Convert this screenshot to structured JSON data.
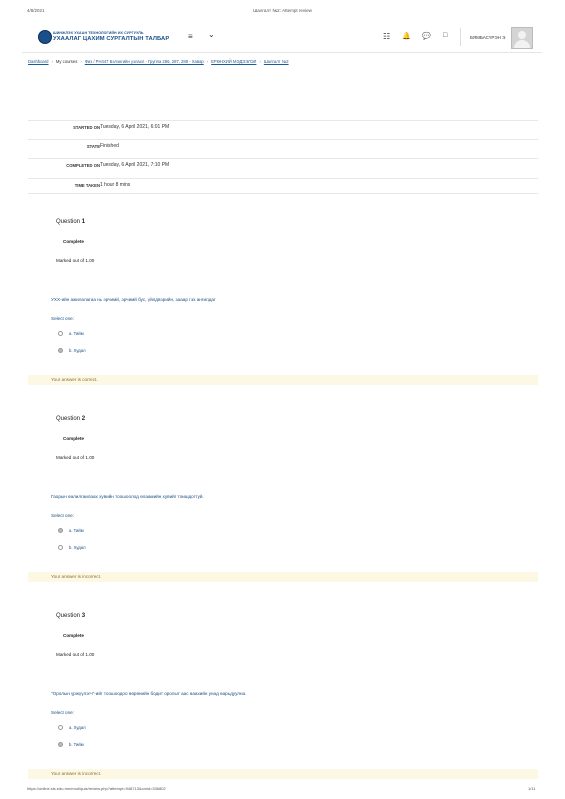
{
  "print_header": {
    "date": "4/8/2021",
    "title": "Шалгалт №2: Attempt review"
  },
  "site": {
    "logo_top": "ШИНЖЛЭХ УХААН ТЕХНОЛОГИЙН ИХ СУРГУУЛЬ",
    "logo_main": "УХААЛАГ ЦАХИМ СУРГАЛТЫН ТАЛБАР"
  },
  "nav": {
    "menu_icon": "≡",
    "dropdown_icon": "⌄",
    "list_icon": "☷",
    "bell_icon": "🔔",
    "chat_icon": "💬",
    "square_icon": "□"
  },
  "user": {
    "name": "БЯМБАСҮРЭН Э"
  },
  "breadcrumb": {
    "items": [
      "Dashboard",
      "My courses",
      "Физ / PH447 Бэлэнгийн узлахл - Группа 286, 287, 288 - Хавар",
      "ЕРӨНХИЙ МЭДЭЭЛЭЛ",
      "Шалгалт №2"
    ]
  },
  "summary": [
    {
      "label": "STARTED ON",
      "value": "Tuesday, 6 April 2021, 6:01 PM"
    },
    {
      "label": "STATE",
      "value": "Finished"
    },
    {
      "label": "COMPLETED ON",
      "value": "Tuesday, 6 April 2021, 7:10 PM"
    },
    {
      "label": "TIME TAKEN",
      "value": "1 hour 8 mins"
    }
  ],
  "questions": [
    {
      "title_prefix": "Question ",
      "number": "1",
      "state": "Complete",
      "mark": "Marked out of 1.00",
      "text": "УХХ-ийн ажилалагаа нь эрчимй, эрчимй бус, үйлдвэрийн, зааар гэх ангилдаг",
      "select": "Select one:",
      "options": [
        "a. Тийм",
        "b. Худал"
      ],
      "selected": 1,
      "feedback": "Your answer is correct."
    },
    {
      "title_prefix": "Question ",
      "number": "2",
      "state": "Complete",
      "mark": "Marked out of 1.00",
      "text": "Гаорын өалилгаилаах хувийн тоошоолод өлаамийн хувийг тоишдогтуй.",
      "select": "Select one:",
      "options": [
        "a. Тийм",
        "b. Худал"
      ],
      "selected": 0,
      "feedback": "Your answer is incorrect."
    },
    {
      "title_prefix": "Question ",
      "number": "3",
      "state": "Complete",
      "mark": "Marked out of 1.00",
      "text": "\"Оролын үржүүлэгч\"-ийг тоошоодоо өөрөнийн бодит оролыт аас өаахийн унад өарьдуулна.",
      "select": "Select one:",
      "options": [
        "a. Худал",
        "b. Тийм"
      ],
      "selected": 1,
      "feedback": "Your answer is incorrect."
    }
  ],
  "print_footer": {
    "url": "https://online.sis.edu.mn/mod/quiz/review.php?attempt=948713&cmid=336802",
    "page": "1/11"
  }
}
